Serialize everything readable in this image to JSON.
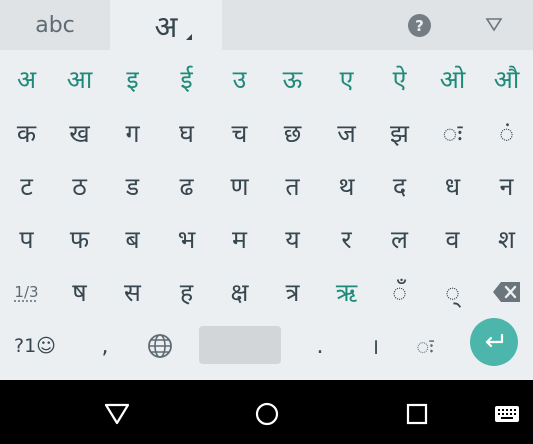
{
  "top_bar": {
    "latin_tab_label": "abc",
    "devanagari_tab_label": "अ"
  },
  "rows": {
    "vowels": [
      "अ",
      "आ",
      "इ",
      "ई",
      "उ",
      "ऊ",
      "ए",
      "ऐ",
      "ओ",
      "औ"
    ],
    "row2": [
      "क",
      "ख",
      "ग",
      "घ",
      "च",
      "छ",
      "ज",
      "झ",
      "ः",
      "ं"
    ],
    "row3": [
      "ट",
      "ठ",
      "ड",
      "ढ",
      "ण",
      "त",
      "थ",
      "द",
      "ध",
      "न"
    ],
    "row4": [
      "प",
      "फ",
      "ब",
      "भ",
      "म",
      "य",
      "र",
      "ल",
      "व",
      "श"
    ],
    "row5": [
      "ष",
      "स",
      "ह",
      "क्ष",
      "त्र",
      "ऋ",
      "ँ",
      "्"
    ]
  },
  "row5_page_indicator": "1/3",
  "bottom_row": {
    "symbols_label": "?1☺",
    "comma_label": ",",
    "period_label": ".",
    "danda_label": "।",
    "visarga_label": "ः"
  },
  "colors": {
    "vowel_text": "#1f8a7a",
    "enter_key": "#4db6ac",
    "background": "#eceff1"
  },
  "icons": [
    "help-icon",
    "collapse-keyboard-icon",
    "delete-icon",
    "globe-icon",
    "enter-icon",
    "back-icon",
    "home-icon",
    "recents-icon",
    "keyboard-switch-icon"
  ]
}
